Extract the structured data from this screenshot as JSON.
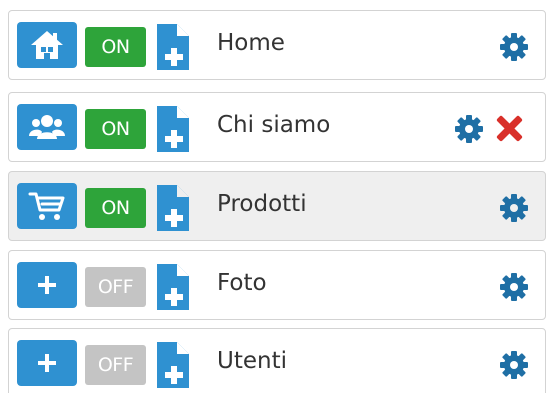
{
  "colors": {
    "icon_bg": "#2f91d1",
    "toggle_on": "#2ea43a",
    "toggle_off": "#c4c4c4",
    "gear": "#1f6fa5",
    "delete": "#d9302a",
    "highlight_row": "#efefef"
  },
  "pages": [
    {
      "icon": "home-icon",
      "status": "ON",
      "label": "Home",
      "actions": [
        "settings"
      ]
    },
    {
      "icon": "users-icon",
      "status": "ON",
      "label": "Chi siamo",
      "actions": [
        "settings",
        "delete"
      ]
    },
    {
      "icon": "cart-icon",
      "status": "ON",
      "label": "Prodotti",
      "actions": [
        "settings"
      ],
      "highlighted": true
    },
    {
      "icon": "plus-icon",
      "status": "OFF",
      "label": "Foto",
      "actions": [
        "settings"
      ]
    },
    {
      "icon": "plus-icon",
      "status": "OFF",
      "label": "Utenti",
      "actions": [
        "settings"
      ]
    }
  ]
}
